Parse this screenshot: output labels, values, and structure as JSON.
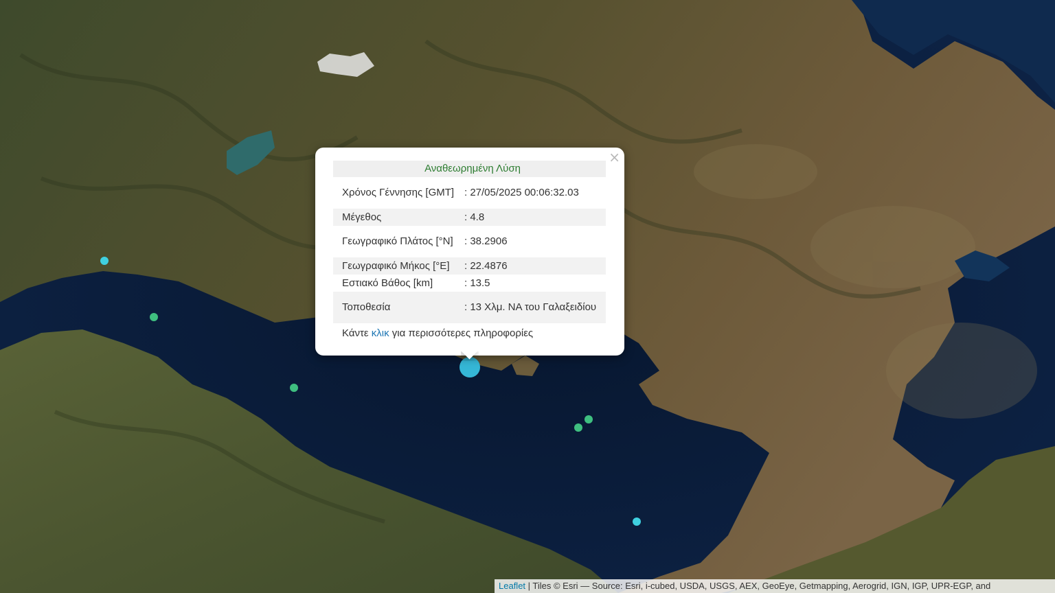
{
  "popup": {
    "title": "Αναθεωρημένη Λύση",
    "close_glyph": "×",
    "rows": [
      {
        "label": "Χρόνος Γέννησης [GMT]",
        "value": ": 27/05/2025 00:06:32.03"
      },
      {
        "label": "Μέγεθος",
        "value": ": 4.8"
      },
      {
        "label": "Γεωγραφικό Πλάτος [°N]",
        "value": ": 38.2906"
      },
      {
        "label": "Γεωγραφικό Μήκος [°E]",
        "value": ": 22.4876"
      },
      {
        "label": "Εστιακό Βάθος [km]",
        "value": ": 13.5"
      },
      {
        "label": "Τοποθεσία",
        "value": ": 13 Χλμ. ΝΑ του Γαλαξειδίου"
      }
    ],
    "more_prefix": "Κάντε ",
    "more_link": "κλικ",
    "more_suffix": " για περισσότερες πληροφορίες"
  },
  "attribution": {
    "link": "Leaflet",
    "text": " | Tiles © Esri — Source: Esri, i-cubed, USDA, USGS, AEX, GeoEye, Getmapping, Aerogrid, IGN, IGP, UPR-EGP, and"
  },
  "colors": {
    "selected_marker": "#35b7d6",
    "recent_marker": "#3fd0e0",
    "older_marker": "#3fbf80",
    "sea": "#0b1a33",
    "land": "#4a5a36"
  }
}
